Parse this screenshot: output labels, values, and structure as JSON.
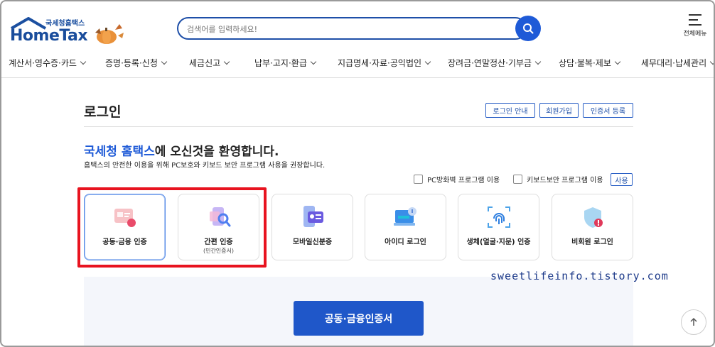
{
  "header": {
    "logo_small": "국세청홈택스",
    "logo_main": "HomeTax",
    "search_placeholder": "검색어를 입력하세요!",
    "menu_all": "전체메뉴"
  },
  "nav": {
    "items": [
      "계산서·영수증·카드",
      "증명·등록·신청",
      "세금신고",
      "납부·고지·환급",
      "지급명세·자료·공익법인",
      "장려금·연말정산·기부금",
      "상담·불복·제보",
      "세무대리·납세관리"
    ]
  },
  "main": {
    "title": "로그인",
    "top_buttons": [
      "로그인 안내",
      "회원가입",
      "인증서 등록"
    ],
    "welcome_highlight": "국세청 홈택스",
    "welcome_rest": "에 오신것을 환영합니다.",
    "subtitle": "홈택스의 안전한 이용을 위해 PC보호와 키보드 보안 프로그램 사용을 권장합니다.",
    "checkbox_pc": "PC방화벽 프로그램 이용",
    "checkbox_kb": "키보드보안 프로그램 이용",
    "use_button": "사용",
    "cards": [
      {
        "label": "공동·금융 인증",
        "sub": "",
        "icon": "certificate-icon"
      },
      {
        "label": "간편 인증",
        "sub": "(민간인증서)",
        "icon": "simple-auth-icon"
      },
      {
        "label": "모바일신분증",
        "sub": "",
        "icon": "mobile-id-icon"
      },
      {
        "label": "아이디 로그인",
        "sub": "",
        "icon": "id-login-icon"
      },
      {
        "label": "생체(얼굴·지문) 인증",
        "sub": "",
        "icon": "fingerprint-icon"
      },
      {
        "label": "비회원 로그인",
        "sub": "",
        "icon": "guest-shield-icon"
      }
    ],
    "cert_button": "공동·금융인증서"
  },
  "watermark": "sweetlifeinfo.tistory.com",
  "colors": {
    "brand_blue": "#1e5ad7",
    "highlight_red": "#e8131f",
    "cta_blue": "#1f57c9"
  }
}
